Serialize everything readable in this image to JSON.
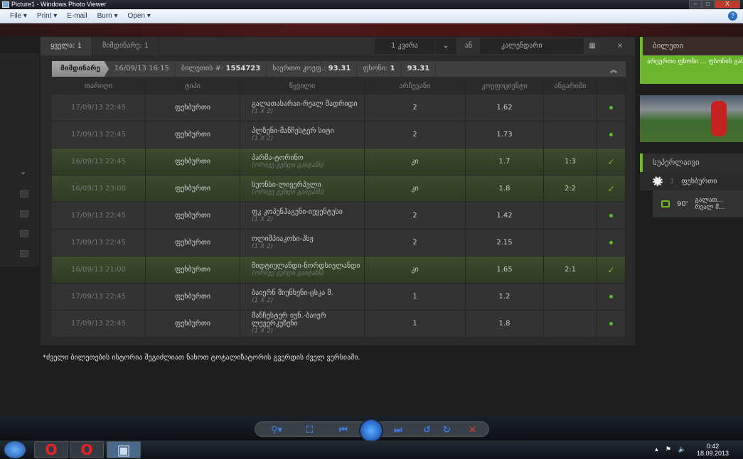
{
  "window": {
    "title": "Picture1 - Windows Photo Viewer",
    "menu": [
      "File ▾",
      "Print ▾",
      "E-mail",
      "Burn ▾",
      "Open ▾"
    ],
    "help": "?"
  },
  "tabs": {
    "all": "ყველა: 1",
    "current": "მიმდინარე: 1"
  },
  "filter": {
    "period": "1 კვირა",
    "or": "ან",
    "calendar": "კალენდარი",
    "close": "×"
  },
  "ticket": {
    "status": "მიმდინარე",
    "datetime": "16/09/13 16:15",
    "number_label": "ბილეთის #:",
    "number": "1554723",
    "total_coef_label": "საერთო კოეფ.:",
    "total_coef": "93.31",
    "stake_label": "ფსონი:",
    "stake": "1",
    "payout": "93.31"
  },
  "columns": [
    "თარიღი",
    "ტიპი",
    "წყვილი",
    "არჩევანი",
    "კოეფიციენტი",
    "ანგარიში"
  ],
  "rows": [
    {
      "date": "17/09/13 22:45",
      "type": "ფეხბურთი",
      "pair": "გალათასარაი-რეალ მადრიდი",
      "market": "(1 X 2)",
      "choice": "2",
      "coef": "1.62",
      "score": "",
      "win": false
    },
    {
      "date": "17/09/13 22:45",
      "type": "ფეხბურთი",
      "pair": "პლზენი-მანჩესტერ სიტი",
      "market": "(1 X 2)",
      "choice": "2",
      "coef": "1.73",
      "score": "",
      "win": false
    },
    {
      "date": "16/09/13 22:45",
      "type": "ფეხბურთი",
      "pair": "პარმა-ტორინო",
      "market": "(ორივე გუნდი გაიტანს)",
      "choice": "კი",
      "coef": "1.7",
      "score": "1:3",
      "win": true
    },
    {
      "date": "16/09/13 23:00",
      "type": "ფეხბურთი",
      "pair": "სუონსი-ლივერპული",
      "market": "(ორივე გუნდი გაიტანს)",
      "choice": "კი",
      "coef": "1.8",
      "score": "2:2",
      "win": true
    },
    {
      "date": "17/09/13 22:45",
      "type": "ფეხბურთი",
      "pair": "ფკ კოპენჰაგენი-იუვენტუსი",
      "market": "(1 X 2)",
      "choice": "2",
      "coef": "1.42",
      "score": "",
      "win": false
    },
    {
      "date": "17/09/13 22:45",
      "type": "ფეხბურთი",
      "pair": "ოლიმპიაკოსი-პსჟ",
      "market": "(1 X 2)",
      "choice": "2",
      "coef": "2.15",
      "score": "",
      "win": false
    },
    {
      "date": "16/09/13 21:00",
      "type": "ფეხბურთი",
      "pair": "მიდტიულანდი-ნორდსიელანდი",
      "market": "(ორივე გუნდი გაიტანს)",
      "choice": "კი",
      "coef": "1.65",
      "score": "2:1",
      "win": true
    },
    {
      "date": "17/09/13 22:45",
      "type": "ფეხბურთი",
      "pair": "ბაიერნ მიუნხენი-ცსკა მ.",
      "market": "(1 X 2)",
      "choice": "1",
      "coef": "1.2",
      "score": "",
      "win": false
    },
    {
      "date": "17/09/13 22:45",
      "type": "ფეხბურთი",
      "pair": "მანჩესტერ იუნ.-ბაიერ ლევერკუზენი",
      "market": "(1 X 2)",
      "choice": "1",
      "coef": "1.8",
      "score": "",
      "win": false
    }
  ],
  "note": "*ძველი ბილეთების ისტორია შეგიძლიათ ნახოთ ტოტალიზატორის გვერდის ძველ ვერსიაში.",
  "right": {
    "ticket_title": "ბილეთი",
    "promo": "არცერთი ფსონი ... ფსონის გასაკეთ... მონიშნეთ სასურ...",
    "live_title": "სუპერლაივი",
    "sport_count": "1",
    "sport": "ფეხბურთი",
    "minute": "90'",
    "match": "გალათ... რეალ მ..."
  },
  "taskbar": {
    "time": "0:42",
    "date": "18.09.2013"
  }
}
